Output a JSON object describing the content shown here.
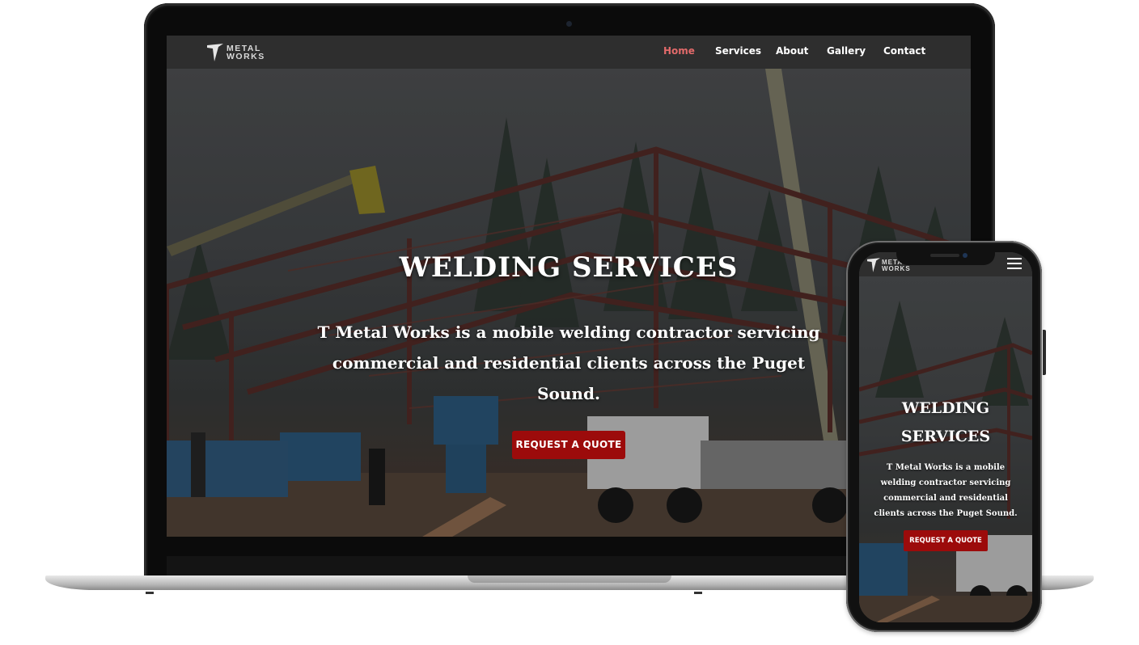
{
  "brand": {
    "logo_line1": "METAL",
    "logo_line2": "WORKS",
    "accent_color": "#9c0b0b",
    "active_nav_color": "#e26a6a"
  },
  "desktop": {
    "nav": {
      "items": [
        {
          "label": "Home",
          "active": true
        },
        {
          "label": "Services",
          "active": false
        },
        {
          "label": "About",
          "active": false
        },
        {
          "label": "Gallery",
          "active": false
        },
        {
          "label": "Contact",
          "active": false
        }
      ]
    },
    "hero": {
      "title": "WELDING SERVICES",
      "text": "T Metal Works is a mobile welding contractor servicing commercial and residential clients across the Puget Sound.",
      "cta_label": "REQUEST A QUOTE"
    }
  },
  "mobile": {
    "menu_icon": "hamburger-icon",
    "hero": {
      "title": "WELDING SERVICES",
      "text": "T Metal Works is a mobile welding contractor servicing commercial and residential clients across the Puget Sound.",
      "cta_label": "REQUEST A QUOTE"
    }
  }
}
